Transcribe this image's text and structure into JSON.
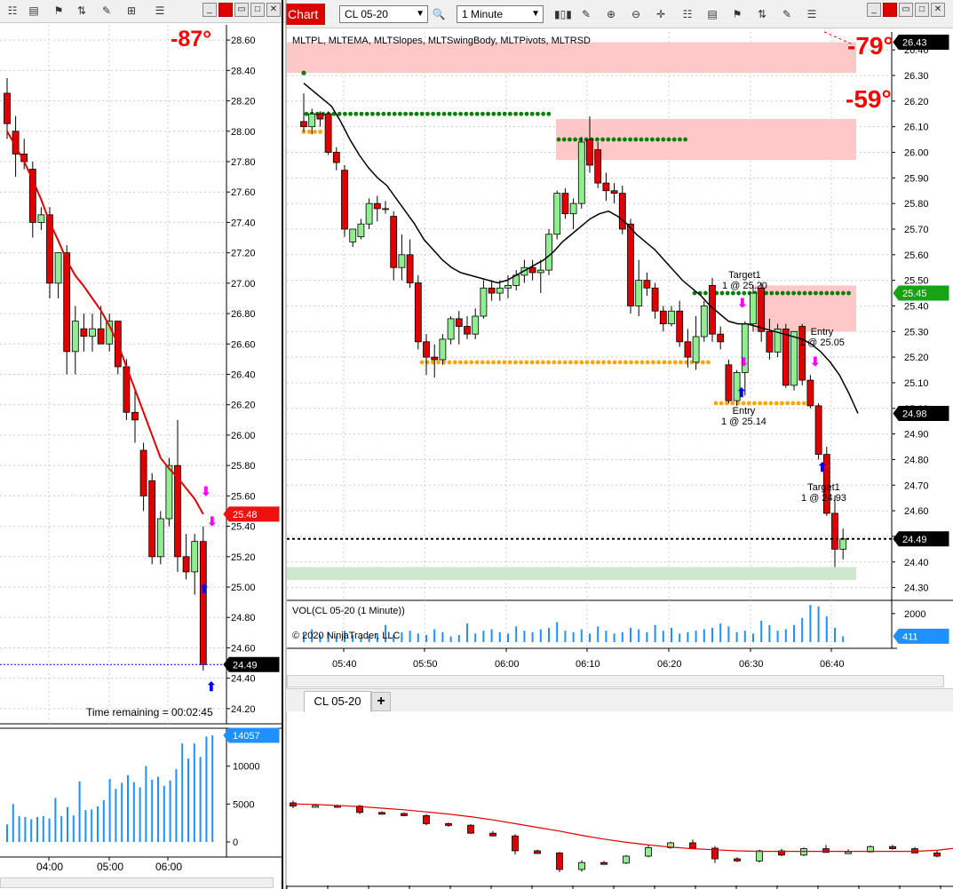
{
  "toolbar": {
    "chart_tab_label": "Chart",
    "instrument_value": "CL 05-20",
    "interval_value": "1 Minute",
    "icons": [
      "search-icon",
      "bar-style-icon",
      "pencil-icon",
      "zoom-in-icon",
      "zoom-out-icon",
      "crosshair-icon",
      "properties-icon",
      "data-box-icon",
      "strategies-icon",
      "indicators-icon",
      "price-markers-icon"
    ]
  },
  "tabs": {
    "active_label": "CL 05-20",
    "add_label": "+"
  },
  "colors": {
    "up_candle": "#90ee90",
    "down_candle": "#e00000",
    "ema_black": "#000000",
    "ema_red": "#e00000",
    "volume": "#1e90ff",
    "swing_high": "#008000",
    "swing_low": "#ffa500",
    "zone_red": "#ffc8c8",
    "zone_green": "#cde8cd",
    "buy_arrow": "#0000ff",
    "sell_arrow": "#ff00ff",
    "angle_text": "#ff0000"
  },
  "chart_data": [
    {
      "type": "candlestick",
      "panel": "left-price",
      "angle_label": "-87°",
      "last_price_label": "25.48",
      "current_price_label": "24.49",
      "timer_label": "Time remaining = 00:02:45",
      "y_ticks": [
        "28.60",
        "28.40",
        "28.20",
        "28.00",
        "27.80",
        "27.60",
        "27.40",
        "27.20",
        "27.00",
        "26.80",
        "26.60",
        "26.40",
        "26.20",
        "26.00",
        "25.80",
        "25.60",
        "25.40",
        "25.20",
        "25.00",
        "24.80",
        "24.60",
        "24.40",
        "24.20"
      ],
      "ylim": [
        24.1,
        28.7
      ],
      "candles": [
        {
          "o": 28.25,
          "h": 28.35,
          "l": 27.95,
          "c": 28.05
        },
        {
          "o": 28.0,
          "h": 28.1,
          "l": 27.7,
          "c": 27.85
        },
        {
          "o": 27.85,
          "h": 27.95,
          "l": 27.75,
          "c": 27.8
        },
        {
          "o": 27.75,
          "h": 27.8,
          "l": 27.3,
          "c": 27.4
        },
        {
          "o": 27.4,
          "h": 27.5,
          "l": 27.35,
          "c": 27.45
        },
        {
          "o": 27.45,
          "h": 27.5,
          "l": 26.9,
          "c": 27.0
        },
        {
          "o": 27.0,
          "h": 27.2,
          "l": 26.9,
          "c": 27.2
        },
        {
          "o": 27.2,
          "h": 27.25,
          "l": 26.4,
          "c": 26.55
        },
        {
          "o": 26.55,
          "h": 26.85,
          "l": 26.4,
          "c": 26.75
        },
        {
          "o": 26.7,
          "h": 26.8,
          "l": 26.55,
          "c": 26.65
        },
        {
          "o": 26.65,
          "h": 26.8,
          "l": 26.55,
          "c": 26.7
        },
        {
          "o": 26.7,
          "h": 26.85,
          "l": 26.6,
          "c": 26.6
        },
        {
          "o": 26.6,
          "h": 26.8,
          "l": 26.55,
          "c": 26.75
        },
        {
          "o": 26.75,
          "h": 26.75,
          "l": 26.4,
          "c": 26.45
        },
        {
          "o": 26.45,
          "h": 26.5,
          "l": 26.1,
          "c": 26.15
        },
        {
          "o": 26.15,
          "h": 26.3,
          "l": 25.95,
          "c": 26.1
        },
        {
          "o": 25.9,
          "h": 25.95,
          "l": 25.5,
          "c": 25.6
        },
        {
          "o": 25.7,
          "h": 25.75,
          "l": 25.15,
          "c": 25.2
        },
        {
          "o": 25.2,
          "h": 25.5,
          "l": 25.15,
          "c": 25.45
        },
        {
          "o": 25.45,
          "h": 25.85,
          "l": 25.4,
          "c": 25.8
        },
        {
          "o": 25.8,
          "h": 26.1,
          "l": 25.1,
          "c": 25.2
        },
        {
          "o": 25.2,
          "h": 25.35,
          "l": 25.05,
          "c": 25.1
        },
        {
          "o": 25.1,
          "h": 25.35,
          "l": 24.95,
          "c": 25.3
        },
        {
          "o": 25.3,
          "h": 25.4,
          "l": 24.45,
          "c": 24.49
        }
      ],
      "ema": [
        28.0,
        27.9,
        27.8,
        27.68,
        27.55,
        27.4,
        27.28,
        27.15,
        27.05,
        26.98,
        26.9,
        26.82,
        26.72,
        26.6,
        26.45,
        26.3,
        26.15,
        26.0,
        25.85,
        25.78,
        25.72,
        25.65,
        25.58,
        25.48
      ]
    },
    {
      "type": "bar",
      "panel": "left-volume",
      "last_value_label": "14057",
      "y_ticks": [
        "10000",
        "5000",
        "0"
      ],
      "ylim": [
        0,
        15000
      ],
      "x_ticks": [
        "04:00",
        "05:00",
        "06:00"
      ],
      "values": [
        2300,
        5000,
        3400,
        3300,
        3000,
        3300,
        3400,
        3100,
        5800,
        3400,
        4600,
        3500,
        8000,
        4200,
        4300,
        4700,
        5500,
        8300,
        7000,
        7800,
        8800,
        7900,
        7200,
        10000,
        8200,
        8600,
        7400,
        8100,
        9600,
        13000,
        11000,
        13000,
        11200,
        13900,
        14057
      ]
    },
    {
      "type": "candlestick",
      "panel": "right-price",
      "indicator_list": "MLTPL, MLTEMA, MLTSlopes, MLTSwingBody, MLTPivots, MLTRSD",
      "angle_labels": [
        "-79°",
        "-59°"
      ],
      "price_labels": [
        "26.43",
        "25.45",
        "24.98",
        "24.49"
      ],
      "y_ticks": [
        "26.40",
        "26.30",
        "26.20",
        "26.10",
        "26.00",
        "25.90",
        "25.80",
        "25.70",
        "25.60",
        "25.50",
        "25.40",
        "25.30",
        "25.20",
        "25.10",
        "25.00",
        "24.90",
        "24.80",
        "24.70",
        "24.60",
        "24.50",
        "24.40",
        "24.30"
      ],
      "ylim": [
        24.25,
        26.47
      ],
      "x_ticks": [
        "05:40",
        "05:50",
        "06:00",
        "06:10",
        "06:20",
        "06:30",
        "06:40"
      ],
      "annotations": [
        {
          "text": "Target1",
          "line2": "1 @ 25.20"
        },
        {
          "text": "Entry",
          "line2": "1 @ 25.05"
        },
        {
          "text": "Entry",
          "line2": "1 @ 25.14"
        },
        {
          "text": "Target1",
          "line2": "1 @ 24.93"
        }
      ],
      "candles": [
        {
          "o": 26.12,
          "h": 26.23,
          "l": 26.08,
          "c": 26.1
        },
        {
          "o": 26.1,
          "h": 26.17,
          "l": 26.07,
          "c": 26.15
        },
        {
          "o": 26.15,
          "h": 26.16,
          "l": 26.1,
          "c": 26.13
        },
        {
          "o": 26.15,
          "h": 26.16,
          "l": 25.99,
          "c": 26.0
        },
        {
          "o": 26.0,
          "h": 26.02,
          "l": 25.93,
          "c": 25.96
        },
        {
          "o": 25.93,
          "h": 25.95,
          "l": 25.67,
          "c": 25.7
        },
        {
          "o": 25.65,
          "h": 25.7,
          "l": 25.63,
          "c": 25.7
        },
        {
          "o": 25.67,
          "h": 25.74,
          "l": 25.66,
          "c": 25.72
        },
        {
          "o": 25.72,
          "h": 25.82,
          "l": 25.7,
          "c": 25.8
        },
        {
          "o": 25.8,
          "h": 25.83,
          "l": 25.73,
          "c": 25.78
        },
        {
          "o": 25.78,
          "h": 25.81,
          "l": 25.76,
          "c": 25.78
        },
        {
          "o": 25.75,
          "h": 25.77,
          "l": 25.5,
          "c": 25.55
        },
        {
          "o": 25.55,
          "h": 25.68,
          "l": 25.5,
          "c": 25.6
        },
        {
          "o": 25.6,
          "h": 25.66,
          "l": 25.47,
          "c": 25.49
        },
        {
          "o": 25.49,
          "h": 25.52,
          "l": 25.23,
          "c": 25.26
        },
        {
          "o": 25.26,
          "h": 25.29,
          "l": 25.13,
          "c": 25.2
        },
        {
          "o": 25.2,
          "h": 25.25,
          "l": 25.12,
          "c": 25.19
        },
        {
          "o": 25.19,
          "h": 25.29,
          "l": 25.17,
          "c": 25.27
        },
        {
          "o": 25.27,
          "h": 25.36,
          "l": 25.25,
          "c": 25.35
        },
        {
          "o": 25.35,
          "h": 25.38,
          "l": 25.25,
          "c": 25.32
        },
        {
          "o": 25.32,
          "h": 25.36,
          "l": 25.27,
          "c": 25.29
        },
        {
          "o": 25.29,
          "h": 25.39,
          "l": 25.27,
          "c": 25.36
        },
        {
          "o": 25.36,
          "h": 25.5,
          "l": 25.35,
          "c": 25.47
        },
        {
          "o": 25.47,
          "h": 25.5,
          "l": 25.42,
          "c": 25.45
        },
        {
          "o": 25.45,
          "h": 25.5,
          "l": 25.42,
          "c": 25.47
        },
        {
          "o": 25.47,
          "h": 25.52,
          "l": 25.43,
          "c": 25.48
        },
        {
          "o": 25.48,
          "h": 25.54,
          "l": 25.46,
          "c": 25.52
        },
        {
          "o": 25.52,
          "h": 25.58,
          "l": 25.49,
          "c": 25.55
        },
        {
          "o": 25.55,
          "h": 25.58,
          "l": 25.5,
          "c": 25.53
        },
        {
          "o": 25.53,
          "h": 25.58,
          "l": 25.45,
          "c": 25.54
        },
        {
          "o": 25.54,
          "h": 25.7,
          "l": 25.52,
          "c": 25.68
        },
        {
          "o": 25.68,
          "h": 25.85,
          "l": 25.66,
          "c": 25.84
        },
        {
          "o": 25.84,
          "h": 25.86,
          "l": 25.74,
          "c": 25.76
        },
        {
          "o": 25.76,
          "h": 25.82,
          "l": 25.7,
          "c": 25.8
        },
        {
          "o": 25.8,
          "h": 26.06,
          "l": 25.78,
          "c": 26.04
        },
        {
          "o": 26.05,
          "h": 26.14,
          "l": 25.92,
          "c": 25.95
        },
        {
          "o": 26.01,
          "h": 26.04,
          "l": 25.86,
          "c": 25.88
        },
        {
          "o": 25.88,
          "h": 25.92,
          "l": 25.81,
          "c": 25.85
        },
        {
          "o": 25.85,
          "h": 25.88,
          "l": 25.8,
          "c": 25.84
        },
        {
          "o": 25.84,
          "h": 25.87,
          "l": 25.68,
          "c": 25.7
        },
        {
          "o": 25.72,
          "h": 25.74,
          "l": 25.37,
          "c": 25.4
        },
        {
          "o": 25.4,
          "h": 25.58,
          "l": 25.36,
          "c": 25.5
        },
        {
          "o": 25.5,
          "h": 25.53,
          "l": 25.44,
          "c": 25.47
        },
        {
          "o": 25.47,
          "h": 25.49,
          "l": 25.35,
          "c": 25.38
        },
        {
          "o": 25.38,
          "h": 25.4,
          "l": 25.3,
          "c": 25.33
        },
        {
          "o": 25.33,
          "h": 25.4,
          "l": 25.32,
          "c": 25.38
        },
        {
          "o": 25.38,
          "h": 25.42,
          "l": 25.24,
          "c": 25.26
        },
        {
          "o": 25.26,
          "h": 25.31,
          "l": 25.16,
          "c": 25.2
        },
        {
          "o": 25.18,
          "h": 25.36,
          "l": 25.15,
          "c": 25.28
        },
        {
          "o": 25.28,
          "h": 25.42,
          "l": 25.26,
          "c": 25.4
        },
        {
          "o": 25.48,
          "h": 25.51,
          "l": 25.26,
          "c": 25.29
        },
        {
          "o": 25.29,
          "h": 25.32,
          "l": 25.23,
          "c": 25.26
        },
        {
          "o": 25.17,
          "h": 25.19,
          "l": 25.02,
          "c": 25.03
        },
        {
          "o": 25.03,
          "h": 25.15,
          "l": 25.01,
          "c": 25.14
        },
        {
          "o": 25.14,
          "h": 25.34,
          "l": 25.05,
          "c": 25.33
        },
        {
          "o": 25.33,
          "h": 25.48,
          "l": 25.3,
          "c": 25.45
        },
        {
          "o": 25.47,
          "h": 25.49,
          "l": 25.26,
          "c": 25.3
        },
        {
          "o": 25.3,
          "h": 25.35,
          "l": 25.19,
          "c": 25.22
        },
        {
          "o": 25.22,
          "h": 25.33,
          "l": 25.2,
          "c": 25.31
        },
        {
          "o": 25.31,
          "h": 25.33,
          "l": 25.08,
          "c": 25.09
        },
        {
          "o": 25.09,
          "h": 25.29,
          "l": 25.07,
          "c": 25.3
        },
        {
          "o": 25.32,
          "h": 25.33,
          "l": 25.09,
          "c": 25.11
        },
        {
          "o": 25.11,
          "h": 25.13,
          "l": 25.0,
          "c": 25.01
        },
        {
          "o": 25.01,
          "h": 25.02,
          "l": 24.8,
          "c": 24.82
        },
        {
          "o": 24.82,
          "h": 24.85,
          "l": 24.58,
          "c": 24.59
        },
        {
          "o": 24.59,
          "h": 24.66,
          "l": 24.38,
          "c": 24.45
        },
        {
          "o": 24.45,
          "h": 24.53,
          "l": 24.41,
          "c": 24.49
        }
      ],
      "ema": [
        26.27,
        26.24,
        26.21,
        26.18,
        26.12,
        26.05,
        25.99,
        25.94,
        25.9,
        25.87,
        25.82,
        25.77,
        25.72,
        25.66,
        25.62,
        25.58,
        25.55,
        25.53,
        25.52,
        25.51,
        25.5,
        25.49,
        25.5,
        25.52,
        25.54,
        25.56,
        25.58,
        25.61,
        25.65,
        25.68,
        25.71,
        25.74,
        25.76,
        25.77,
        25.75,
        25.72,
        25.68,
        25.65,
        25.62,
        25.58,
        25.54,
        25.5,
        25.47,
        25.44,
        25.4,
        25.37,
        25.34,
        25.33,
        25.33,
        25.32,
        25.31,
        25.3,
        25.29,
        25.28,
        25.27,
        25.25,
        25.22,
        25.18,
        25.13,
        25.06,
        24.98
      ]
    },
    {
      "type": "bar",
      "panel": "right-volume",
      "title": "VOL(CL 05-20 (1 Minute))",
      "copyright": "© 2020 NinjaTrader, LLC",
      "y_ticks": [
        "2000"
      ],
      "last_value_label": "411",
      "ylim": [
        0,
        2800
      ],
      "values": [
        600,
        900,
        500,
        700,
        400,
        800,
        500,
        300,
        400,
        600,
        1200,
        500,
        700,
        800,
        600,
        500,
        900,
        700,
        400,
        500,
        1300,
        600,
        800,
        900,
        700,
        600,
        1100,
        800,
        700,
        900,
        1000,
        1400,
        800,
        700,
        900,
        600,
        1100,
        800,
        600,
        700,
        1000,
        900,
        700,
        1200,
        800,
        1000,
        600,
        700,
        800,
        900,
        1000,
        1300,
        1100,
        700,
        800,
        600,
        1500,
        1200,
        800,
        900,
        1200,
        1700,
        2600,
        2500,
        1800,
        1000,
        411
      ]
    },
    {
      "type": "candlestick",
      "panel": "bottom-price",
      "candles": [
        {
          "o": 6.0,
          "h": 5.6,
          "l": 7.0,
          "c": 6.6
        },
        {
          "o": 6.6,
          "h": 6.3,
          "l": 6.8,
          "c": 6.5
        },
        {
          "o": 6.5,
          "h": 6.3,
          "l": 6.9,
          "c": 6.7
        },
        {
          "o": 6.6,
          "h": 6.4,
          "l": 8.1,
          "c": 7.8
        },
        {
          "o": 7.8,
          "h": 7.6,
          "l": 8.2,
          "c": 8.0
        },
        {
          "o": 8.0,
          "h": 7.8,
          "l": 8.5,
          "c": 8.4
        },
        {
          "o": 8.4,
          "h": 8.1,
          "l": 10.2,
          "c": 9.9
        },
        {
          "o": 9.9,
          "h": 9.7,
          "l": 10.5,
          "c": 10.2
        },
        {
          "o": 10.2,
          "h": 10.0,
          "l": 11.8,
          "c": 11.7
        },
        {
          "o": 11.7,
          "h": 11.3,
          "l": 12.3,
          "c": 12.2
        },
        {
          "o": 12.2,
          "h": 11.9,
          "l": 15.7,
          "c": 15.0
        },
        {
          "o": 15.0,
          "h": 14.8,
          "l": 15.6,
          "c": 15.5
        },
        {
          "o": 15.4,
          "h": 15.2,
          "l": 19.0,
          "c": 18.5
        },
        {
          "o": 18.5,
          "h": 16.8,
          "l": 18.9,
          "c": 17.2
        },
        {
          "o": 17.2,
          "h": 16.9,
          "l": 17.6,
          "c": 17.3
        },
        {
          "o": 17.3,
          "h": 15.8,
          "l": 17.5,
          "c": 16.0
        },
        {
          "o": 16.0,
          "h": 14.0,
          "l": 16.2,
          "c": 14.4
        },
        {
          "o": 14.4,
          "h": 13.3,
          "l": 14.6,
          "c": 13.5
        },
        {
          "o": 13.5,
          "h": 12.9,
          "l": 14.4,
          "c": 14.5
        },
        {
          "o": 14.5,
          "h": 14.1,
          "l": 17.3,
          "c": 16.5
        },
        {
          "o": 16.5,
          "h": 16.2,
          "l": 17.1,
          "c": 16.9
        },
        {
          "o": 16.9,
          "h": 14.8,
          "l": 17.2,
          "c": 15.0
        },
        {
          "o": 15.0,
          "h": 14.6,
          "l": 16.0,
          "c": 15.8
        },
        {
          "o": 15.8,
          "h": 14.4,
          "l": 16.0,
          "c": 14.6
        },
        {
          "o": 14.6,
          "h": 13.9,
          "l": 15.2,
          "c": 15.3
        },
        {
          "o": 15.3,
          "h": 14.7,
          "l": 15.5,
          "c": 15.2
        },
        {
          "o": 15.2,
          "h": 14.0,
          "l": 15.3,
          "c": 14.2
        },
        {
          "o": 14.2,
          "h": 13.9,
          "l": 14.8,
          "c": 14.6
        },
        {
          "o": 14.6,
          "h": 14.3,
          "l": 15.4,
          "c": 15.4
        },
        {
          "o": 15.4,
          "h": 14.9,
          "l": 16.2,
          "c": 16.0
        },
        {
          "o": 15.1,
          "h": 11.0,
          "l": 16.0,
          "c": 11.3
        },
        {
          "o": 11.3,
          "h": 10.6,
          "l": 11.6,
          "c": 10.8
        },
        {
          "o": 10.8,
          "h": 10.3,
          "l": 11.3,
          "c": 10.5
        }
      ],
      "ema": [
        6.2,
        6.3,
        6.5,
        6.7,
        7.0,
        7.3,
        7.7,
        8.1,
        8.6,
        9.2,
        9.9,
        10.6,
        11.3,
        12.1,
        12.8,
        13.4,
        13.9,
        14.3,
        14.6,
        14.8,
        15.0,
        15.1,
        15.1,
        15.1,
        15.1,
        15.1,
        15.1,
        15.1,
        15.1,
        14.9,
        14.4,
        13.8,
        13.3
      ]
    }
  ]
}
